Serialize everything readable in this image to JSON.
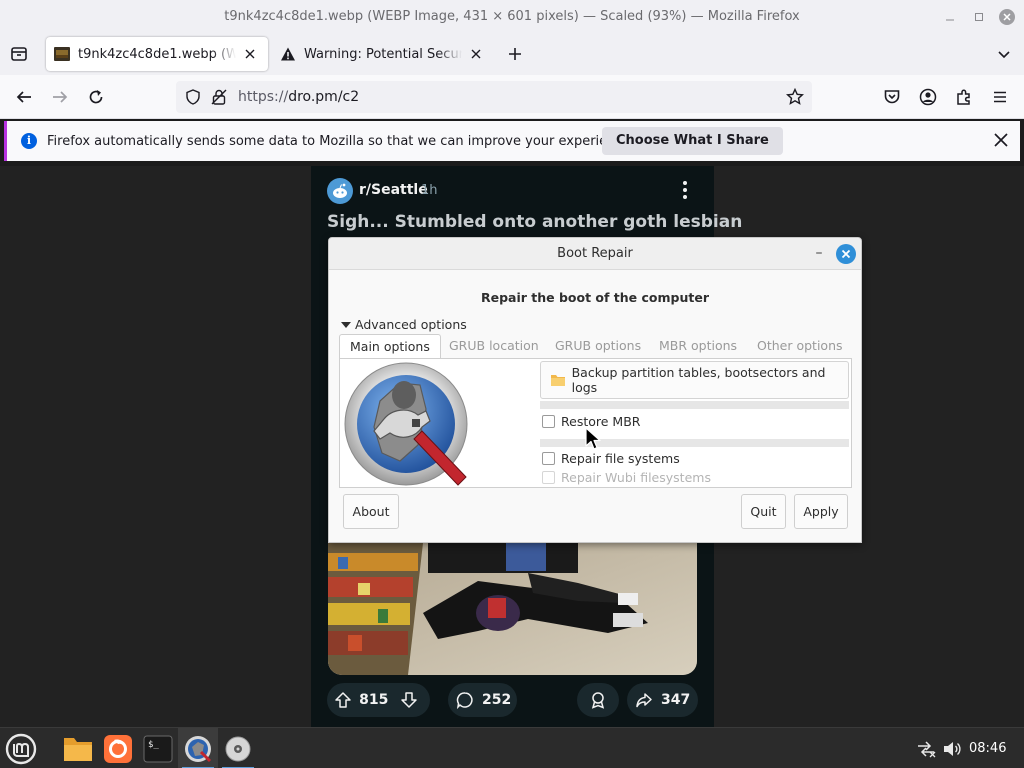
{
  "window": {
    "title": "t9nk4zc4c8de1.webp (WEBP Image, 431 × 601 pixels) — Scaled (93%) — Mozilla Firefox"
  },
  "tabs": [
    {
      "label": "t9nk4zc4c8de1.webp (WEBP Image, 431 × 601 pixels)",
      "active": true
    },
    {
      "label": "Warning: Potential Security Risk Ahead",
      "active": false
    }
  ],
  "navbar": {
    "url_prefix": "https://",
    "url_host": "dro.pm/c2"
  },
  "notification": {
    "text": "Firefox automatically sends some data to Mozilla so that we can improve your experience.",
    "button": "Choose What I Share"
  },
  "post": {
    "subreddit": "r/Seattle",
    "age": "1h",
    "title": "Sigh... Stumbled onto another goth lesbian",
    "upvotes": "815",
    "comments": "252",
    "shares": "347"
  },
  "dialog": {
    "title": "Boot Repair",
    "heading": "Repair the boot of the computer",
    "expander": "Advanced options",
    "tabs": [
      "Main options",
      "GRUB location",
      "GRUB options",
      "MBR options",
      "Other options"
    ],
    "backup_button": "Backup partition tables, bootsectors and logs",
    "checkboxes": {
      "restore_mbr": "Restore MBR",
      "repair_fs": "Repair file systems",
      "repair_wubi": "Repair Wubi filesystems"
    },
    "buttons": {
      "about": "About",
      "quit": "Quit",
      "apply": "Apply"
    }
  },
  "taskbar": {
    "clock": "08:46"
  },
  "colors": {
    "firefox_accent": "#0060df",
    "notification_stripe": "#b833e1",
    "dialog_close": "#2f8fd8",
    "post_background": "#0b1416"
  }
}
